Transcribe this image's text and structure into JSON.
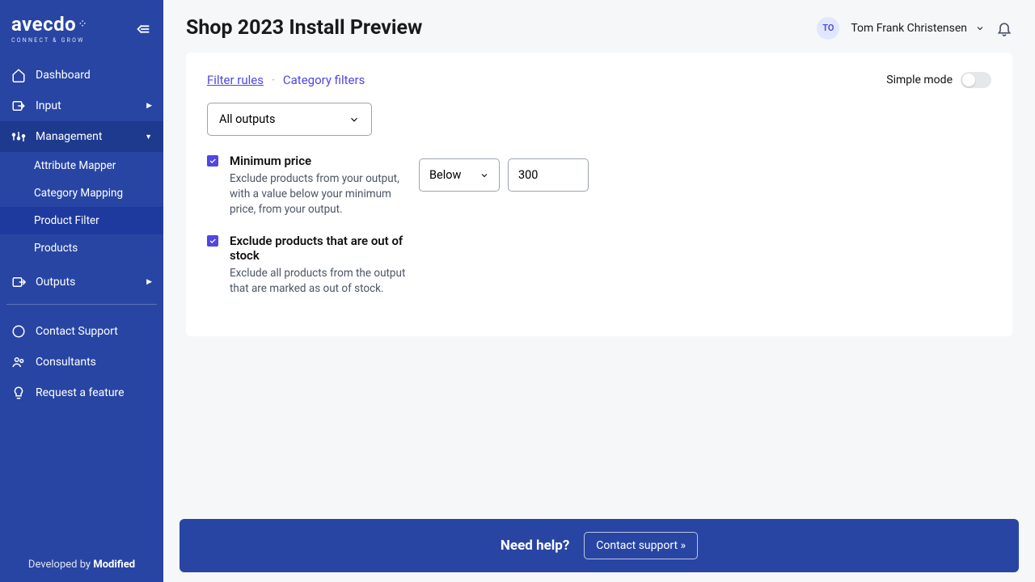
{
  "brand": {
    "name": "avecdo",
    "tagline": "CONNECT & GROW"
  },
  "sidebar": {
    "items": [
      {
        "label": "Dashboard"
      },
      {
        "label": "Input"
      },
      {
        "label": "Management"
      },
      {
        "label": "Outputs"
      }
    ],
    "management_sub": [
      {
        "label": "Attribute Mapper"
      },
      {
        "label": "Category Mapping"
      },
      {
        "label": "Product Filter"
      },
      {
        "label": "Products"
      }
    ],
    "support": [
      {
        "label": "Contact Support"
      },
      {
        "label": "Consultants"
      },
      {
        "label": "Request a feature"
      }
    ],
    "footer_prefix": "Developed by ",
    "footer_brand": "Modified"
  },
  "header": {
    "title": "Shop 2023 Install Preview",
    "user_initials": "TO",
    "user_name": "Tom Frank Christensen"
  },
  "tabs": {
    "filter_rules": "Filter rules",
    "category_filters": "Category filters",
    "separator": "·",
    "simple_mode_label": "Simple mode"
  },
  "outputs_select": "All outputs",
  "filters": {
    "min_price": {
      "title": "Minimum price",
      "desc": "Exclude products from your output, with a value below your minimum price, from your output.",
      "comparator": "Below",
      "value": "300"
    },
    "out_of_stock": {
      "title": "Exclude products that are out of stock",
      "desc": "Exclude all products from the output that are marked as out of stock."
    }
  },
  "help": {
    "text": "Need help?",
    "button": "Contact support »"
  }
}
